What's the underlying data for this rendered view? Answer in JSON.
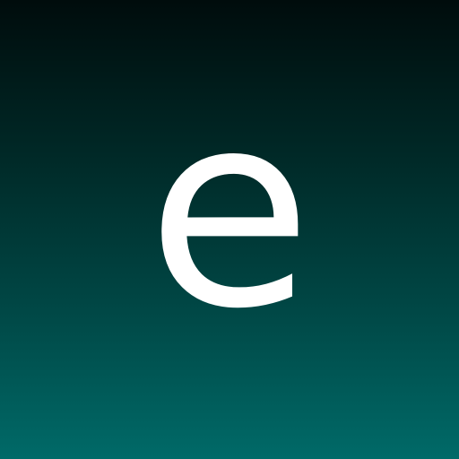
{
  "icon": {
    "letter": "e",
    "letter_color": "#ffffff",
    "background_gradient": [
      "#000c0c",
      "#006a68"
    ]
  }
}
